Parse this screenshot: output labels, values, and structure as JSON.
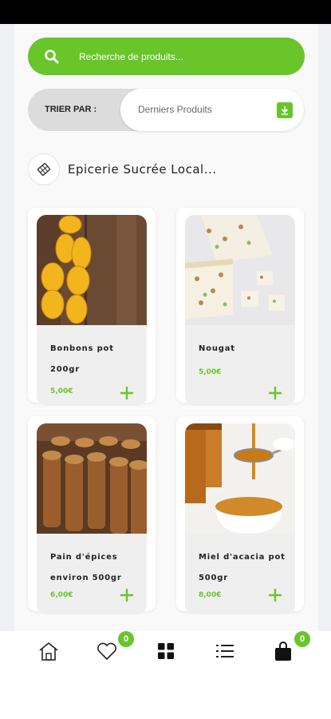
{
  "colors": {
    "accent": "#69c52a",
    "text": "#222222"
  },
  "search": {
    "placeholder": "Recherche de produits..."
  },
  "sort": {
    "label": "TRIER PAR :",
    "value": "Derniers Produits"
  },
  "category": {
    "name": "Epicerie Sucrée Local...",
    "icon": "candy-category-icon"
  },
  "products": [
    {
      "title": "Bonbons pot",
      "subtitle": "200gr",
      "price": "5,00€"
    },
    {
      "title": "Nougat",
      "subtitle": "",
      "price": "5,00€"
    },
    {
      "title": "Pain d'épices",
      "subtitle": "environ 500gr",
      "price": "6,00€"
    },
    {
      "title": "Miel d'acacia pot",
      "subtitle": "500gr",
      "price": "8,00€"
    }
  ],
  "tabbar": {
    "home_icon": "home-icon",
    "favorites_icon": "heart-icon",
    "favorites_count": "0",
    "categories_icon": "grid-icon",
    "list_icon": "list-icon",
    "cart_icon": "shopping-bag-icon",
    "cart_count": "0"
  }
}
